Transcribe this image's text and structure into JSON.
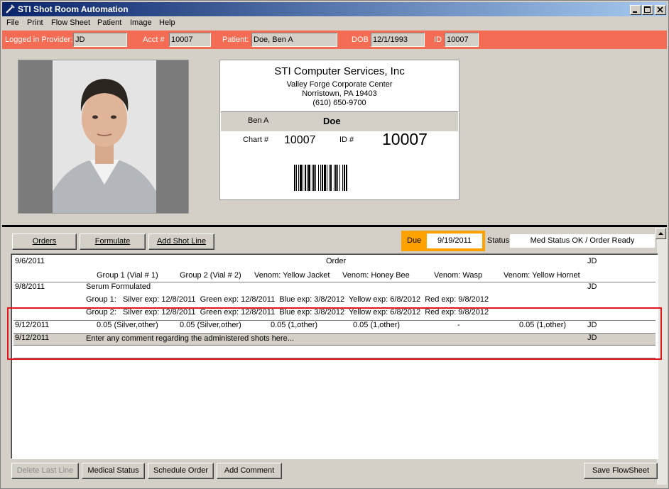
{
  "window": {
    "title": "STI Shot Room Automation"
  },
  "menu": [
    "File",
    "Print",
    "Flow Sheet",
    "Patient",
    "Image",
    "Help"
  ],
  "info": {
    "provider_label": "Logged in Provider:",
    "provider": "JD",
    "acct_label": "Acct #",
    "acct": "10007",
    "patient_label": "Patient:",
    "patient": "Doe, Ben A",
    "dob_label": "DOB",
    "dob": "12/1/1993",
    "id_label": "ID",
    "id": "10007"
  },
  "card": {
    "company": "STI Computer Services, Inc",
    "addr1": "Valley Forge Corporate Center",
    "addr2": "Norristown, PA 19403",
    "phone": "(610) 650-9700",
    "first": "Ben A",
    "last": "Doe",
    "chart_label": "Chart #",
    "chart": "10007",
    "id_label": "ID #",
    "id": "10007"
  },
  "toolbar": {
    "orders": "Orders",
    "formulate": "Formulate",
    "add_shot": "Add Shot Line"
  },
  "due": {
    "label": "Due",
    "value": "9/19/2011"
  },
  "status": {
    "label": "Status",
    "value": "Med Status OK / Order Ready"
  },
  "sheet": {
    "r1": {
      "date": "9/6/2011",
      "title": "Order",
      "user": "JD"
    },
    "headers": [
      "Group 1 (Vial # 1)",
      "Group 2 (Vial # 2)",
      "Venom: Yellow Jacket",
      "Venom: Honey Bee",
      "Venom: Wasp",
      "Venom: Yellow Hornet"
    ],
    "r2": {
      "date": "9/8/2011",
      "title": "Serum Formulated",
      "user": "JD"
    },
    "g1": "Group 1:   Silver exp: 12/8/2011  Green exp: 12/8/2011  Blue exp: 3/8/2012  Yellow exp: 6/8/2012  Red exp: 9/8/2012",
    "g2": "Group 2:   Silver exp: 12/8/2011  Green exp: 12/8/2011  Blue exp: 3/8/2012  Yellow exp: 6/8/2012  Red exp: 9/8/2012",
    "shot": {
      "date": "9/12/2011",
      "vals": [
        "0.05 (Silver,other)",
        "0.05 (Silver,other)",
        "0.05 (1,other)",
        "0.05 (1,other)",
        "-",
        "0.05 (1,other)"
      ],
      "user": "JD"
    },
    "comment": {
      "date": "9/12/2011",
      "text": "Enter any comment regarding the administered shots here...",
      "user": "JD"
    }
  },
  "bottom": {
    "delete": "Delete Last Line",
    "medical": "Medical Status",
    "schedule": "Schedule Order",
    "comment": "Add Comment",
    "save": "Save FlowSheet"
  }
}
